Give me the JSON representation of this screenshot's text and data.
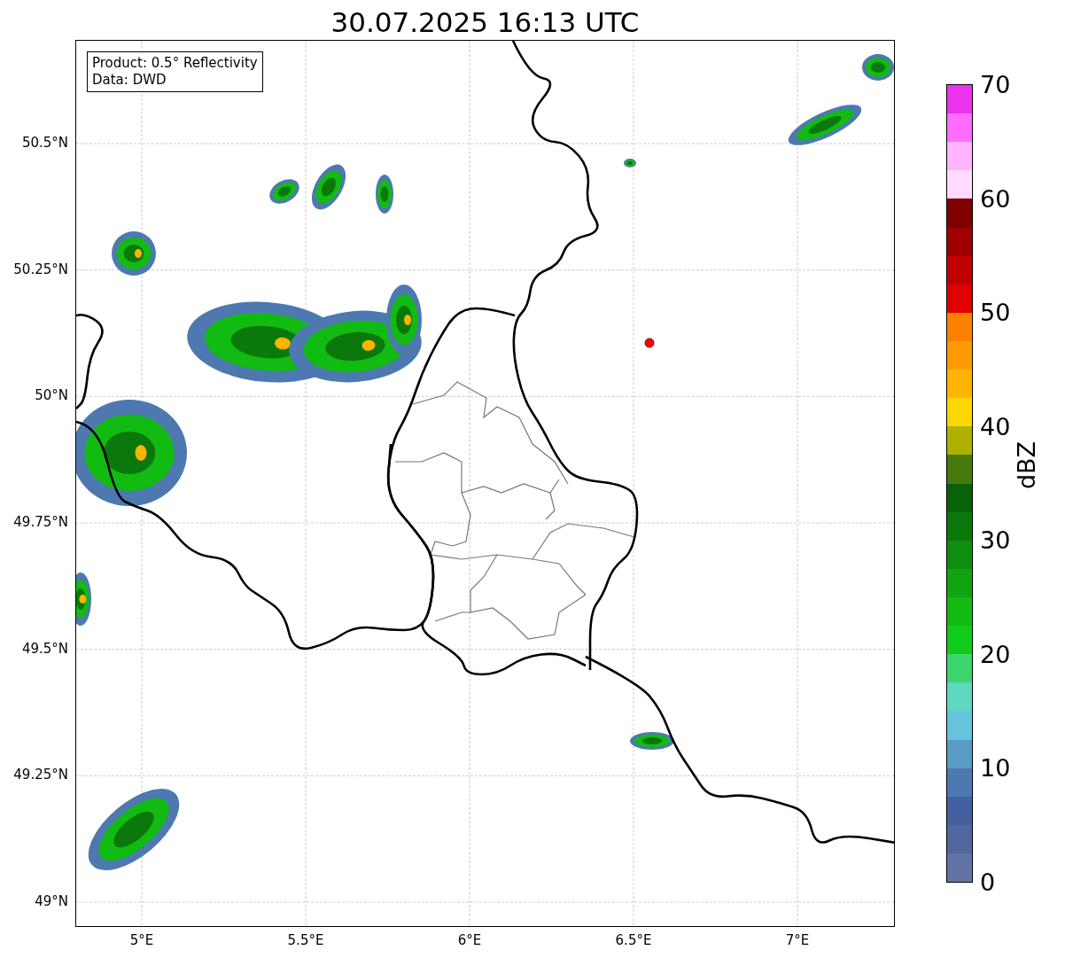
{
  "title": "30.07.2025 16:13 UTC",
  "legend": [
    "Product: 0.5° Reflectivity",
    "Data: DWD"
  ],
  "lat_labels": [
    "50.5°N",
    "50.25°N",
    "50°N",
    "49.75°N",
    "49.5°N",
    "49.25°N",
    "49°N"
  ],
  "lon_labels": [
    "5°E",
    "5.5°E",
    "6°E",
    "6.5°E",
    "7°E"
  ],
  "colorbar": {
    "label": "dBZ",
    "ticks": [
      "70",
      "60",
      "50",
      "40",
      "30",
      "20",
      "10",
      "0"
    ],
    "segments": [
      {
        "color": "#ee33ee"
      },
      {
        "color": "#ff6cff"
      },
      {
        "color": "#ffb4ff"
      },
      {
        "color": "#ffdcff"
      },
      {
        "color": "#800000"
      },
      {
        "color": "#a00000"
      },
      {
        "color": "#c00000"
      },
      {
        "color": "#e00000"
      },
      {
        "color": "#ff7f00"
      },
      {
        "color": "#ff9a00"
      },
      {
        "color": "#ffb400"
      },
      {
        "color": "#ffd700"
      },
      {
        "color": "#b0b000"
      },
      {
        "color": "#467a0c"
      },
      {
        "color": "#086208"
      },
      {
        "color": "#0b780b"
      },
      {
        "color": "#0e8e0e"
      },
      {
        "color": "#10a510"
      },
      {
        "color": "#12bb12"
      },
      {
        "color": "#10cc1a"
      },
      {
        "color": "#3ed46e"
      },
      {
        "color": "#5fd8c2"
      },
      {
        "color": "#66c3dd"
      },
      {
        "color": "#5a9bc5"
      },
      {
        "color": "#4d79b0"
      },
      {
        "color": "#4560a0"
      },
      {
        "color": "#52679f"
      },
      {
        "color": "#6473a5"
      }
    ]
  }
}
